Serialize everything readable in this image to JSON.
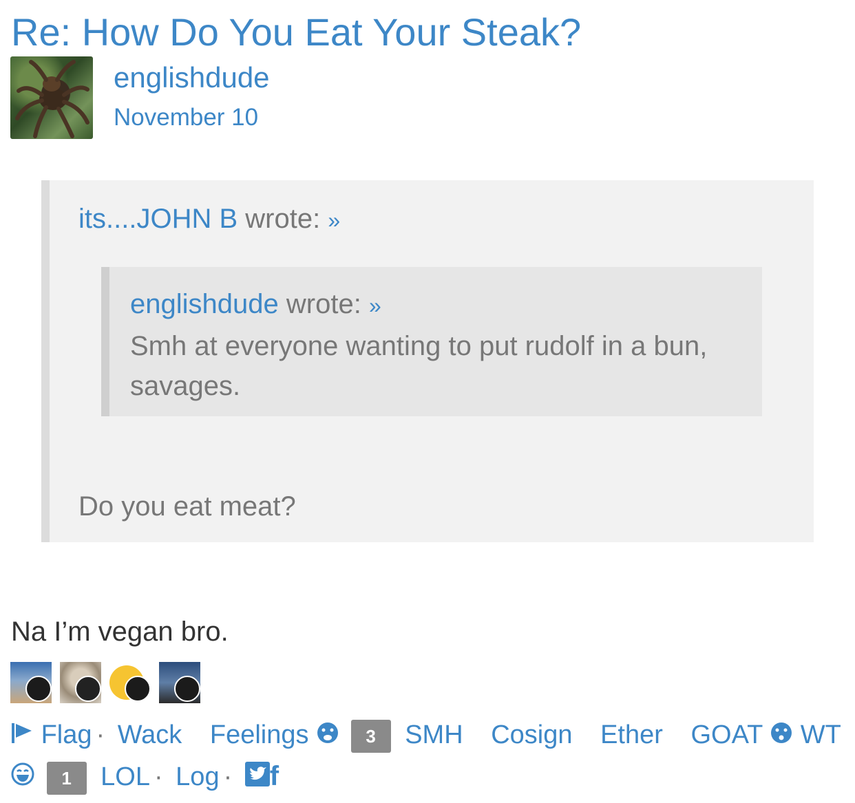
{
  "post": {
    "title": "Re: How Do You Eat Your Steak?",
    "author": "englishdude",
    "date": "November 10",
    "body": "Na I’m vegan bro."
  },
  "quote": {
    "author": "its....JOHN B",
    "wrote_label": "wrote:",
    "arrow": "»",
    "body": "Do you eat meat?",
    "nested": {
      "author": "englishdude",
      "wrote_label": "wrote:",
      "arrow": "»",
      "body": "Smh at everyone wanting to put rudolf in a bun, savages."
    }
  },
  "reactions": {
    "users": [
      "reactor-1",
      "reactor-2",
      "reactor-3",
      "reactor-4"
    ]
  },
  "actions": {
    "flag": "Flag",
    "sep": "·",
    "wack": "Wack",
    "feelings": "Feelings",
    "feelings_count": "3",
    "smh": "SMH",
    "cosign": "Cosign",
    "ether": "Ether",
    "goat": "GOAT",
    "wt": "WT",
    "lol_count": "1",
    "lol": "LOL",
    "log": "Log",
    "share_twitter": "twitter-icon",
    "share_facebook": "f"
  },
  "colors": {
    "link": "#3d87c7",
    "quote_bg": "#f2f2f2",
    "nested_quote_bg": "#e6e6e6",
    "count_badge": "#8a8a8a"
  }
}
